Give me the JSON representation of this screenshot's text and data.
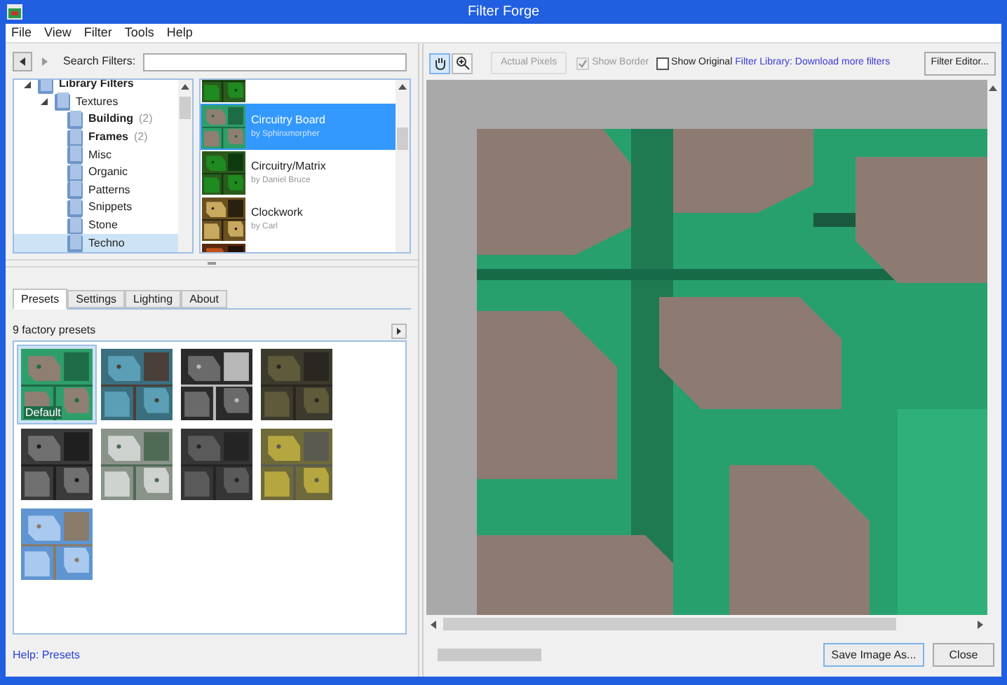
{
  "window": {
    "title": "Filter Forge"
  },
  "menu": [
    "File",
    "View",
    "Filter",
    "Tools",
    "Help"
  ],
  "search": {
    "label": "Search Filters:"
  },
  "tree": [
    {
      "label": "Library Filters",
      "expanded": true,
      "bold": true,
      "selected": false,
      "children": [
        {
          "label": "Textures",
          "expanded": true,
          "bold": false,
          "selected": false,
          "children": [
            {
              "label": "Building",
              "count": "(2)",
              "bold": true,
              "selected": false
            },
            {
              "label": "Frames",
              "count": "(2)",
              "bold": true,
              "selected": false
            },
            {
              "label": "Misc",
              "bold": false,
              "selected": false
            },
            {
              "label": "Organic",
              "bold": false,
              "selected": false
            },
            {
              "label": "Patterns",
              "bold": false,
              "selected": false
            },
            {
              "label": "Snippets",
              "bold": false,
              "selected": false
            },
            {
              "label": "Stone",
              "bold": false,
              "selected": false
            },
            {
              "label": "Techno",
              "bold": false,
              "selected": true
            }
          ]
        }
      ]
    }
  ],
  "filters": [
    {
      "kind": "partial",
      "selected": false
    },
    {
      "kind": "full",
      "title": "Circuitry Board",
      "author": "by Sphinxmorpher",
      "selected": true
    },
    {
      "kind": "full",
      "title": "Circuitry/Matrix",
      "author": "by Daniel Bruce",
      "selected": false
    },
    {
      "kind": "full",
      "title": "Clockwork",
      "author": "by Carl",
      "selected": false
    },
    {
      "kind": "partial",
      "selected": false
    }
  ],
  "tabs": [
    {
      "label": "Presets",
      "selected": true
    },
    {
      "label": "Settings",
      "selected": false
    },
    {
      "label": "Lighting",
      "selected": false
    },
    {
      "label": "About",
      "selected": false
    }
  ],
  "presets_count": "9 factory presets",
  "presets": [
    {
      "label": "Default",
      "selected": true
    },
    {
      "selected": false
    },
    {
      "selected": false
    },
    {
      "selected": false
    },
    {
      "selected": false
    },
    {
      "selected": false
    },
    {
      "selected": false
    },
    {
      "selected": false
    },
    {
      "selected": false
    }
  ],
  "help_link": "Help: Presets",
  "toolbar": {
    "tools": [
      {
        "kind": "hand",
        "selected": true
      },
      {
        "kind": "zoom",
        "selected": false
      }
    ],
    "actual_pixels": {
      "label": "Actual Pixels",
      "disabled": true
    },
    "show_border": {
      "label": "Show Border",
      "checked": true,
      "disabled": true
    },
    "show_original": {
      "label": "Show Original",
      "checked": false,
      "disabled": false
    },
    "library_link": "Filter Library: Download more filters",
    "filter_editor": "Filter Editor..."
  },
  "buttons": [
    "Save Image As...",
    "Close"
  ]
}
